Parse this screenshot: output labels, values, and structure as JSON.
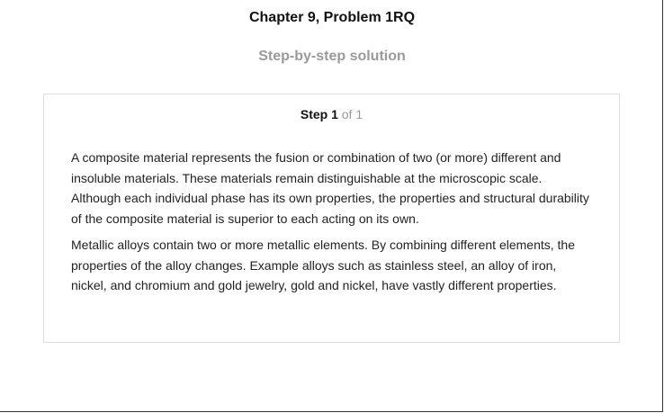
{
  "header": {
    "title": "Chapter 9, Problem 1RQ",
    "subtitle": "Step-by-step solution"
  },
  "step": {
    "label": "Step 1",
    "of_text": "of 1"
  },
  "solution": {
    "paragraphs": [
      "A composite material represents the fusion or combination of two (or more) different and insoluble materials. These materials remain distinguishable at the microscopic scale. Although each individual phase has its own properties, the properties and structural durability of the composite material is superior to each acting on its own.",
      "Metallic alloys contain two or more metallic elements. By combining different elements, the properties of the alloy changes. Example alloys such as stainless steel, an alloy of iron, nickel, and chromium and gold jewelry, gold and nickel, have vastly different properties."
    ]
  }
}
